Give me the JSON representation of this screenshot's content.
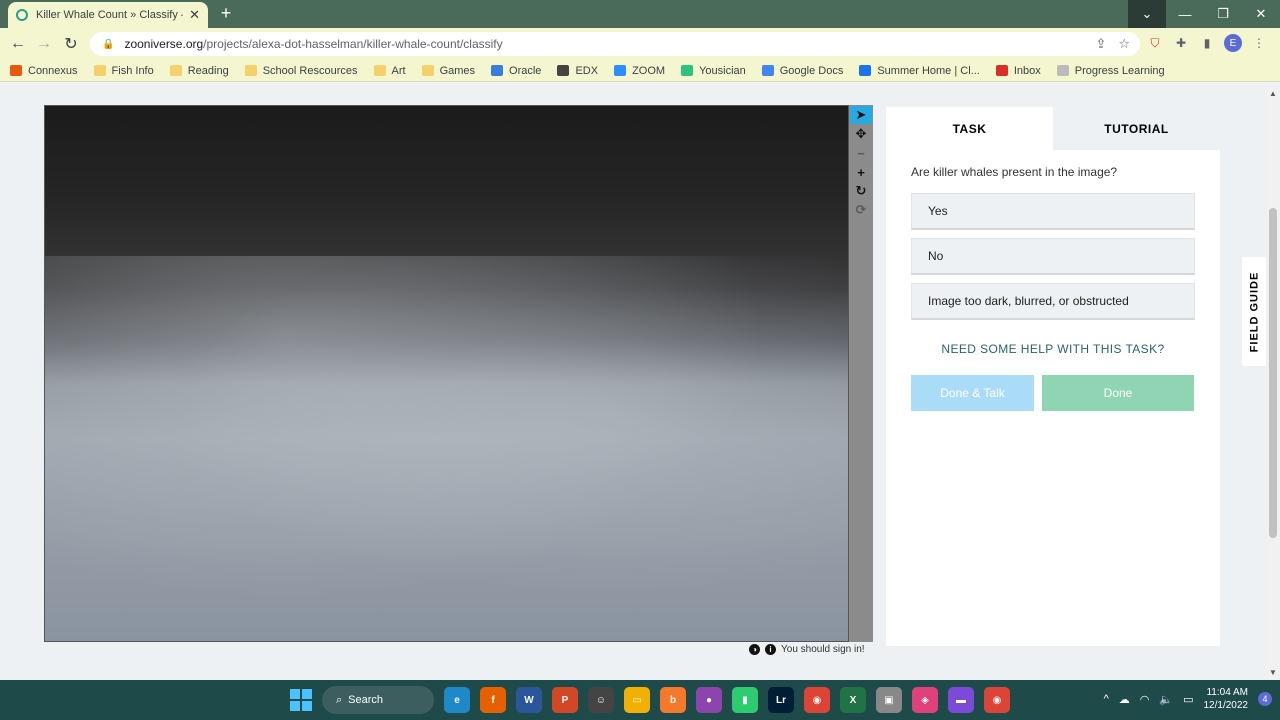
{
  "browser": {
    "tab": {
      "title": "Killer Whale Count » Classify — Z",
      "close": "✕"
    },
    "new_tab": "+",
    "window_controls": [
      "⌄",
      "—",
      "❐",
      "✕"
    ],
    "url": {
      "host": "zooniverse.org",
      "path": "/projects/alexa-dot-hasselman/killer-whale-count/classify"
    },
    "profile_initial": "E",
    "bookmarks": [
      {
        "label": "Connexus",
        "color": "#e8590c"
      },
      {
        "label": "Fish Info",
        "color": "#f5d06b"
      },
      {
        "label": "Reading",
        "color": "#f5d06b"
      },
      {
        "label": "School Rescources",
        "color": "#f5d06b"
      },
      {
        "label": "Art",
        "color": "#f5d06b"
      },
      {
        "label": "Games",
        "color": "#f5d06b"
      },
      {
        "label": "Oracle",
        "color": "#3b7ddd"
      },
      {
        "label": "EDX",
        "color": "#444444"
      },
      {
        "label": "ZOOM",
        "color": "#2d8cff"
      },
      {
        "label": "Yousician",
        "color": "#2ec27e"
      },
      {
        "label": "Google Docs",
        "color": "#4285f4"
      },
      {
        "label": "Summer Home | Cl...",
        "color": "#1a73e8"
      },
      {
        "label": "Inbox",
        "color": "#d93025"
      },
      {
        "label": "Progress Learning",
        "color": "#bbbbbb"
      }
    ]
  },
  "image_tools": [
    {
      "name": "pointer-icon",
      "glyph": "➤",
      "state": "active"
    },
    {
      "name": "pan-icon",
      "glyph": "✥",
      "state": "normal"
    },
    {
      "name": "zoom-out-icon",
      "glyph": "−",
      "state": "disabled"
    },
    {
      "name": "zoom-in-icon",
      "glyph": "+",
      "state": "normal"
    },
    {
      "name": "rotate-icon",
      "glyph": "↻",
      "state": "normal"
    },
    {
      "name": "reset-icon",
      "glyph": "⟳",
      "state": "disabled"
    }
  ],
  "footer_note": {
    "contrast": "◑",
    "info": "i",
    "text": "You should sign in!"
  },
  "task": {
    "tabs": [
      "TASK",
      "TUTORIAL"
    ],
    "question": "Are killer whales present in the image?",
    "answers": [
      "Yes",
      "No",
      "Image too dark, blurred, or obstructed"
    ],
    "help": "NEED SOME HELP WITH THIS TASK?",
    "done_talk": "Done & Talk",
    "done": "Done"
  },
  "field_guide": "FIELD GUIDE",
  "taskbar": {
    "search": "Search",
    "apps": [
      {
        "name": "edge-icon",
        "text": "e",
        "color": "#1e88c9"
      },
      {
        "name": "firefox-icon",
        "text": "f",
        "color": "#e66000"
      },
      {
        "name": "word-icon",
        "text": "W",
        "color": "#2b579a"
      },
      {
        "name": "powerpoint-icon",
        "text": "P",
        "color": "#d24726"
      },
      {
        "name": "app-icon",
        "text": "☺",
        "color": "#444444"
      },
      {
        "name": "file-explorer-icon",
        "text": "▭",
        "color": "#f2b100"
      },
      {
        "name": "blender-icon",
        "text": "b",
        "color": "#f5792a"
      },
      {
        "name": "krita-icon",
        "text": "●",
        "color": "#8e44ad"
      },
      {
        "name": "app2-icon",
        "text": "▮",
        "color": "#2ecc71"
      },
      {
        "name": "lightroom-icon",
        "text": "Lr",
        "color": "#001e36"
      },
      {
        "name": "chrome-icon",
        "text": "◉",
        "color": "#db4437"
      },
      {
        "name": "excel-icon",
        "text": "X",
        "color": "#217346"
      },
      {
        "name": "app3-icon",
        "text": "▣",
        "color": "#888888"
      },
      {
        "name": "app4-icon",
        "text": "◈",
        "color": "#e0407b"
      },
      {
        "name": "clapper-icon",
        "text": "▬",
        "color": "#7b4ad6"
      },
      {
        "name": "chrome-active-icon",
        "text": "◉",
        "color": "#db4437"
      }
    ],
    "tray_caret": "^",
    "time": "11:04 AM",
    "date": "12/1/2022",
    "notifications": "4"
  }
}
